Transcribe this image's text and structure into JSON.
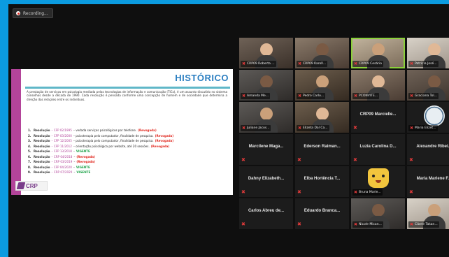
{
  "recording": {
    "label": "Recording..."
  },
  "slide": {
    "title": "HISTÓRICO",
    "paragraph": "A prestação de serviços em psicologia mediada pelas tecnologias de informação e comunicação (TICs), é um assunto discutido no sistema conselhos desde a década de 1990. Cada resolução é pensada conforme uma concepção de homem e de sociedade que determina a direção das relações entre os indivíduos.",
    "resolutions": [
      {
        "num": "1.",
        "head": "Resolução",
        "code": "– CFP 02/1995",
        "text": " – vedada serviços psicológicos por telefone.",
        "tag": "(Revogada)",
        "status": "rev"
      },
      {
        "num": "2.",
        "head": "Resolução",
        "code": "– CFP 03/2000",
        "text": " – psicoterapia pelo computador, finalidade de pesquisa.",
        "tag": "(Revogada)",
        "status": "rev"
      },
      {
        "num": "3.",
        "head": "Resolução",
        "code": "– CFP 12/2005",
        "text": " – psicoterapia pelo computador, finalidade de pesquisa.",
        "tag": "(Revogada)",
        "status": "rev"
      },
      {
        "num": "4.",
        "head": "Resolução",
        "code": "– CFP 11/2012",
        "text": " – orientação psicológica por website, até 20 sessões.",
        "tag": "(Revogada)",
        "status": "rev"
      },
      {
        "num": "5.",
        "head": "Resolução",
        "code": "– CFP 13/2018",
        "text": " – ",
        "tag": "VIGENTE",
        "status": "vig"
      },
      {
        "num": "6.",
        "head": "Resolução",
        "code": "– CRP 04/2018",
        "text": " – ",
        "tag": "(Revogada)",
        "status": "rev"
      },
      {
        "num": "7.",
        "head": "Resolução",
        "code": "– CRP 03/2019",
        "text": " – ",
        "tag": "(Revogada)",
        "status": "rev"
      },
      {
        "num": "8.",
        "head": "Resolução",
        "code": "– CFP 04/2020",
        "text": " – ",
        "tag": "VIGENTE",
        "status": "vig"
      },
      {
        "num": "9.",
        "head": "Resolução",
        "code": "– CRP 07/2020",
        "text": " – ",
        "tag": "VIGENTE",
        "status": "vig"
      }
    ],
    "logo": "CRP"
  },
  "participants": [
    {
      "name": "CRP09 Roberta ...",
      "kind": "video",
      "style": "v1"
    },
    {
      "name": "CRP09 Karoll...",
      "kind": "video",
      "style": "v2"
    },
    {
      "name": "CRP09 Cesário",
      "kind": "video",
      "style": "v3",
      "speaker": true
    },
    {
      "name": "Patrícia José...",
      "kind": "video",
      "style": "v4"
    },
    {
      "name": "Amanda Me...",
      "kind": "video",
      "style": "v5"
    },
    {
      "name": "Pedro Carlo...",
      "kind": "video",
      "style": "v6"
    },
    {
      "name": "PCONVITE...",
      "kind": "video",
      "style": "v2"
    },
    {
      "name": "Graciana Tol...",
      "kind": "video",
      "style": "v1"
    },
    {
      "name": "Juliane Jacos...",
      "kind": "video",
      "style": "v5"
    },
    {
      "name": "Elizeta Dal Ca...",
      "kind": "video",
      "style": "v6"
    },
    {
      "name": "CRP09 Marcielle...",
      "kind": "name"
    },
    {
      "name": "Maria Elizet...",
      "kind": "logo"
    },
    {
      "name": "Marcilene Maga...",
      "kind": "name"
    },
    {
      "name": "Ederson Raiman...",
      "kind": "name"
    },
    {
      "name": "Luzia Carolina D...",
      "kind": "name"
    },
    {
      "name": "Alexandre Ribei...",
      "kind": "name"
    },
    {
      "name": "Dahny Elizabeth...",
      "kind": "name"
    },
    {
      "name": "Elba Hortência T...",
      "kind": "name"
    },
    {
      "name": "Bruna Marie...",
      "kind": "emoji"
    },
    {
      "name": "Maria Mariene F...",
      "kind": "name"
    },
    {
      "name": "Carlos Abreu de...",
      "kind": "name"
    },
    {
      "name": "Eduardo Branca...",
      "kind": "name"
    },
    {
      "name": "Nicole Mican...",
      "kind": "video",
      "style": "v5"
    },
    {
      "name": "Cibele Takan...",
      "kind": "video",
      "style": "v4"
    }
  ]
}
